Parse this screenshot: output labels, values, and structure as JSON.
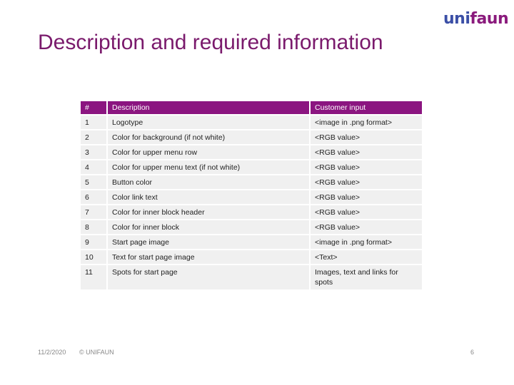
{
  "logo": {
    "part1": "uni",
    "part2": "faun"
  },
  "title": "Description and required information",
  "table": {
    "headers": [
      "#",
      "Description",
      "Customer input"
    ],
    "rows": [
      [
        "1",
        "Logotype",
        "<image in .png format>"
      ],
      [
        "2",
        "Color for background (if not white)",
        "<RGB value>"
      ],
      [
        "3",
        "Color for upper menu row",
        "<RGB value>"
      ],
      [
        "4",
        "Color for upper menu text (if not white)",
        "<RGB value>"
      ],
      [
        "5",
        "Button color",
        "<RGB value>"
      ],
      [
        "6",
        "Color link text",
        "<RGB value>"
      ],
      [
        "7",
        "Color for inner block header",
        "<RGB value>"
      ],
      [
        "8",
        "Color for inner block",
        "<RGB value>"
      ],
      [
        "9",
        "Start page image",
        "<image in .png format>"
      ],
      [
        "10",
        "Text for start page image",
        "<Text>"
      ],
      [
        "11",
        "Spots for start page",
        "Images, text and links for spots"
      ]
    ]
  },
  "footer": {
    "date": "11/2/2020",
    "copyright": "© UNIFAUN",
    "page": "6"
  },
  "colors": {
    "accent": "#8b1580",
    "title": "#7a1a6c",
    "logo_blue": "#3b4fa6"
  }
}
